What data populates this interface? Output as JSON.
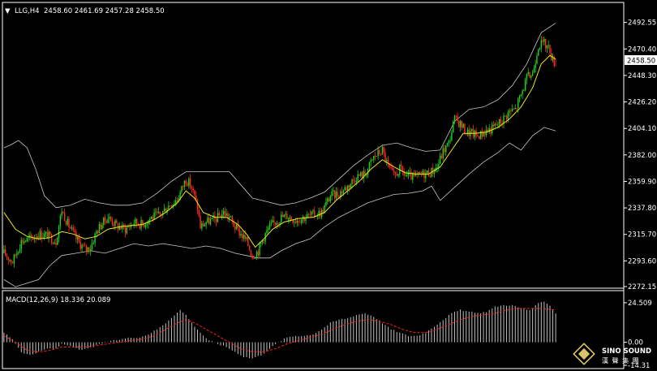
{
  "main_panel": {
    "header_arrow": "▼",
    "symbol": "LLG,H4",
    "ohlc": "2458.60 2461.69 2457.28 2458.50",
    "current_price_label": "2458.50"
  },
  "macd_panel": {
    "title": "MACD(12,26,9) 18.336 20.089"
  },
  "watermark": {
    "brand": "SINO SOUND",
    "chinese": "漢 聲 集 團"
  },
  "colors": {
    "background": "#000000",
    "bull_candle": "#1fd21f",
    "bear_candle": "#ff2a1a",
    "ma_line": "#e8e81e",
    "bands": "#c8c8c8",
    "signal_line": "#ff2020",
    "histogram": "#c0c0c0",
    "panel_border": "#ffffff"
  },
  "chart_data": [
    {
      "type": "candlestick",
      "panel": "price",
      "yticks": [
        2492.55,
        2470.4,
        2448.3,
        2426.2,
        2404.1,
        2382.0,
        2359.9,
        2337.8,
        2315.7,
        2293.6,
        2272.15
      ],
      "ylim": [
        2272.15,
        2495.0
      ],
      "current_price": 2458.5,
      "last_bar": {
        "open": 2458.6,
        "high": 2461.69,
        "low": 2457.28,
        "close": 2458.5
      },
      "close_path": [
        [
          0,
          2300
        ],
        [
          6,
          2293
        ],
        [
          12,
          2310
        ],
        [
          18,
          2312
        ],
        [
          24,
          2316
        ],
        [
          30,
          2315
        ],
        [
          36,
          2310
        ],
        [
          40,
          2336
        ],
        [
          44,
          2325
        ],
        [
          50,
          2312
        ],
        [
          56,
          2303
        ],
        [
          60,
          2305
        ],
        [
          64,
          2318
        ],
        [
          68,
          2325
        ],
        [
          72,
          2330
        ],
        [
          78,
          2323
        ],
        [
          84,
          2320
        ],
        [
          90,
          2326
        ],
        [
          96,
          2324
        ],
        [
          102,
          2330
        ],
        [
          108,
          2332
        ],
        [
          114,
          2340
        ],
        [
          120,
          2345
        ],
        [
          126,
          2362
        ],
        [
          130,
          2355
        ],
        [
          134,
          2338
        ],
        [
          136,
          2322
        ],
        [
          140,
          2326
        ],
        [
          146,
          2328
        ],
        [
          152,
          2334
        ],
        [
          156,
          2330
        ],
        [
          160,
          2322
        ],
        [
          164,
          2316
        ],
        [
          168,
          2310
        ],
        [
          172,
          2298
        ],
        [
          176,
          2302
        ],
        [
          180,
          2314
        ],
        [
          184,
          2322
        ],
        [
          188,
          2326
        ],
        [
          192,
          2330
        ],
        [
          196,
          2331
        ],
        [
          202,
          2328
        ],
        [
          208,
          2330
        ],
        [
          214,
          2332
        ],
        [
          220,
          2334
        ],
        [
          226,
          2348
        ],
        [
          232,
          2350
        ],
        [
          238,
          2356
        ],
        [
          244,
          2364
        ],
        [
          250,
          2366
        ],
        [
          256,
          2380
        ],
        [
          262,
          2386
        ],
        [
          266,
          2372
        ],
        [
          270,
          2364
        ],
        [
          274,
          2370
        ],
        [
          278,
          2365
        ],
        [
          284,
          2363
        ],
        [
          290,
          2366
        ],
        [
          296,
          2368
        ],
        [
          300,
          2372
        ],
        [
          304,
          2385
        ],
        [
          308,
          2392
        ],
        [
          312,
          2412
        ],
        [
          316,
          2408
        ],
        [
          320,
          2401
        ],
        [
          324,
          2400
        ],
        [
          328,
          2398
        ],
        [
          334,
          2402
        ],
        [
          338,
          2404
        ],
        [
          344,
          2410
        ],
        [
          350,
          2418
        ],
        [
          354,
          2420
        ],
        [
          358,
          2432
        ],
        [
          362,
          2446
        ],
        [
          366,
          2450
        ],
        [
          370,
          2474
        ],
        [
          374,
          2475
        ],
        [
          378,
          2470
        ],
        [
          380,
          2460
        ],
        [
          382,
          2458.5
        ]
      ],
      "ma_path": [
        [
          0,
          2334
        ],
        [
          8,
          2320
        ],
        [
          16,
          2314
        ],
        [
          24,
          2312
        ],
        [
          32,
          2313
        ],
        [
          40,
          2318
        ],
        [
          48,
          2316
        ],
        [
          56,
          2312
        ],
        [
          64,
          2314
        ],
        [
          72,
          2320
        ],
        [
          80,
          2322
        ],
        [
          88,
          2323
        ],
        [
          96,
          2324
        ],
        [
          104,
          2328
        ],
        [
          112,
          2334
        ],
        [
          120,
          2342
        ],
        [
          126,
          2352
        ],
        [
          132,
          2346
        ],
        [
          138,
          2334
        ],
        [
          146,
          2330
        ],
        [
          154,
          2330
        ],
        [
          162,
          2324
        ],
        [
          168,
          2316
        ],
        [
          174,
          2305
        ],
        [
          180,
          2312
        ],
        [
          186,
          2320
        ],
        [
          194,
          2326
        ],
        [
          204,
          2329
        ],
        [
          214,
          2330
        ],
        [
          222,
          2334
        ],
        [
          230,
          2344
        ],
        [
          238,
          2352
        ],
        [
          246,
          2360
        ],
        [
          254,
          2370
        ],
        [
          262,
          2378
        ],
        [
          270,
          2372
        ],
        [
          278,
          2367
        ],
        [
          286,
          2366
        ],
        [
          294,
          2366
        ],
        [
          302,
          2372
        ],
        [
          310,
          2386
        ],
        [
          318,
          2400
        ],
        [
          326,
          2400
        ],
        [
          334,
          2401
        ],
        [
          342,
          2405
        ],
        [
          350,
          2412
        ],
        [
          358,
          2422
        ],
        [
          366,
          2438
        ],
        [
          372,
          2458
        ],
        [
          378,
          2465
        ],
        [
          382,
          2462
        ]
      ],
      "upper_band": [
        [
          0,
          2388
        ],
        [
          4,
          2390
        ],
        [
          10,
          2394
        ],
        [
          16,
          2388
        ],
        [
          22,
          2370
        ],
        [
          28,
          2348
        ],
        [
          36,
          2338
        ],
        [
          46,
          2340
        ],
        [
          56,
          2345
        ],
        [
          66,
          2342
        ],
        [
          76,
          2340
        ],
        [
          86,
          2340
        ],
        [
          96,
          2342
        ],
        [
          106,
          2350
        ],
        [
          116,
          2360
        ],
        [
          126,
          2368
        ],
        [
          136,
          2368
        ],
        [
          146,
          2368
        ],
        [
          156,
          2368
        ],
        [
          164,
          2357
        ],
        [
          172,
          2346
        ],
        [
          182,
          2343
        ],
        [
          192,
          2340
        ],
        [
          202,
          2342
        ],
        [
          212,
          2346
        ],
        [
          222,
          2351
        ],
        [
          232,
          2362
        ],
        [
          242,
          2373
        ],
        [
          252,
          2382
        ],
        [
          262,
          2390
        ],
        [
          272,
          2392
        ],
        [
          282,
          2388
        ],
        [
          292,
          2385
        ],
        [
          302,
          2386
        ],
        [
          312,
          2410
        ],
        [
          322,
          2420
        ],
        [
          332,
          2422
        ],
        [
          342,
          2428
        ],
        [
          352,
          2440
        ],
        [
          362,
          2458
        ],
        [
          372,
          2484
        ],
        [
          382,
          2492
        ]
      ],
      "lower_band": [
        [
          0,
          2278
        ],
        [
          8,
          2272
        ],
        [
          16,
          2275
        ],
        [
          24,
          2278
        ],
        [
          32,
          2290
        ],
        [
          40,
          2298
        ],
        [
          50,
          2300
        ],
        [
          60,
          2302
        ],
        [
          70,
          2300
        ],
        [
          80,
          2304
        ],
        [
          90,
          2308
        ],
        [
          100,
          2306
        ],
        [
          110,
          2308
        ],
        [
          120,
          2306
        ],
        [
          130,
          2304
        ],
        [
          140,
          2306
        ],
        [
          150,
          2304
        ],
        [
          160,
          2300
        ],
        [
          168,
          2298
        ],
        [
          176,
          2296
        ],
        [
          184,
          2296
        ],
        [
          192,
          2302
        ],
        [
          202,
          2308
        ],
        [
          212,
          2312
        ],
        [
          222,
          2322
        ],
        [
          232,
          2330
        ],
        [
          242,
          2336
        ],
        [
          252,
          2342
        ],
        [
          262,
          2346
        ],
        [
          270,
          2349
        ],
        [
          280,
          2350
        ],
        [
          290,
          2352
        ],
        [
          296,
          2356
        ],
        [
          302,
          2344
        ],
        [
          312,
          2355
        ],
        [
          322,
          2366
        ],
        [
          332,
          2376
        ],
        [
          342,
          2384
        ],
        [
          350,
          2392
        ],
        [
          358,
          2386
        ],
        [
          366,
          2398
        ],
        [
          374,
          2405
        ],
        [
          382,
          2402
        ]
      ]
    },
    {
      "type": "histogram_line",
      "panel": "macd",
      "title": "MACD(12,26,9) 18.336 20.089",
      "yticks": [
        24.509,
        0.0,
        -14.31
      ],
      "ylim": [
        -14.31,
        28.0
      ],
      "histogram_path": [
        [
          0,
          6
        ],
        [
          6,
          2
        ],
        [
          12,
          -6
        ],
        [
          18,
          -8
        ],
        [
          24,
          -6
        ],
        [
          30,
          -4
        ],
        [
          36,
          -4
        ],
        [
          40,
          -1
        ],
        [
          46,
          -2
        ],
        [
          52,
          -5
        ],
        [
          58,
          -4
        ],
        [
          64,
          -2
        ],
        [
          70,
          0
        ],
        [
          76,
          1
        ],
        [
          82,
          2
        ],
        [
          88,
          3
        ],
        [
          94,
          3
        ],
        [
          100,
          5
        ],
        [
          106,
          8
        ],
        [
          112,
          12
        ],
        [
          118,
          17
        ],
        [
          122,
          20
        ],
        [
          126,
          17
        ],
        [
          130,
          12
        ],
        [
          136,
          6
        ],
        [
          142,
          1
        ],
        [
          148,
          -1
        ],
        [
          154,
          -3
        ],
        [
          160,
          -6
        ],
        [
          166,
          -9
        ],
        [
          172,
          -10
        ],
        [
          178,
          -8
        ],
        [
          184,
          -4
        ],
        [
          190,
          0
        ],
        [
          196,
          3
        ],
        [
          202,
          4
        ],
        [
          208,
          4
        ],
        [
          214,
          5
        ],
        [
          220,
          8
        ],
        [
          226,
          12
        ],
        [
          232,
          14
        ],
        [
          238,
          15
        ],
        [
          244,
          17
        ],
        [
          250,
          18
        ],
        [
          256,
          16
        ],
        [
          262,
          12
        ],
        [
          268,
          8
        ],
        [
          274,
          6
        ],
        [
          280,
          4
        ],
        [
          286,
          4
        ],
        [
          292,
          6
        ],
        [
          298,
          10
        ],
        [
          304,
          14
        ],
        [
          310,
          18
        ],
        [
          316,
          20
        ],
        [
          322,
          19
        ],
        [
          328,
          18
        ],
        [
          334,
          19
        ],
        [
          340,
          22
        ],
        [
          346,
          23
        ],
        [
          352,
          23
        ],
        [
          358,
          21
        ],
        [
          364,
          20
        ],
        [
          370,
          24
        ],
        [
          374,
          25
        ],
        [
          378,
          23
        ],
        [
          382,
          18
        ]
      ],
      "signal_path": [
        [
          0,
          4
        ],
        [
          8,
          0
        ],
        [
          16,
          -5
        ],
        [
          24,
          -6
        ],
        [
          32,
          -5
        ],
        [
          40,
          -3
        ],
        [
          48,
          -3
        ],
        [
          56,
          -3
        ],
        [
          64,
          -2
        ],
        [
          72,
          -1
        ],
        [
          80,
          0
        ],
        [
          88,
          1
        ],
        [
          96,
          2
        ],
        [
          104,
          4
        ],
        [
          112,
          8
        ],
        [
          120,
          12
        ],
        [
          126,
          14
        ],
        [
          132,
          12
        ],
        [
          140,
          8
        ],
        [
          148,
          4
        ],
        [
          156,
          0
        ],
        [
          164,
          -4
        ],
        [
          172,
          -6
        ],
        [
          180,
          -6
        ],
        [
          188,
          -4
        ],
        [
          196,
          -1
        ],
        [
          204,
          1
        ],
        [
          212,
          3
        ],
        [
          220,
          5
        ],
        [
          228,
          8
        ],
        [
          236,
          11
        ],
        [
          244,
          13
        ],
        [
          252,
          14
        ],
        [
          260,
          13
        ],
        [
          268,
          11
        ],
        [
          276,
          8
        ],
        [
          284,
          6
        ],
        [
          292,
          6
        ],
        [
          300,
          8
        ],
        [
          308,
          11
        ],
        [
          316,
          14
        ],
        [
          324,
          16
        ],
        [
          332,
          17
        ],
        [
          340,
          18
        ],
        [
          348,
          20
        ],
        [
          356,
          21
        ],
        [
          364,
          21
        ],
        [
          372,
          21
        ],
        [
          382,
          20
        ]
      ]
    }
  ]
}
